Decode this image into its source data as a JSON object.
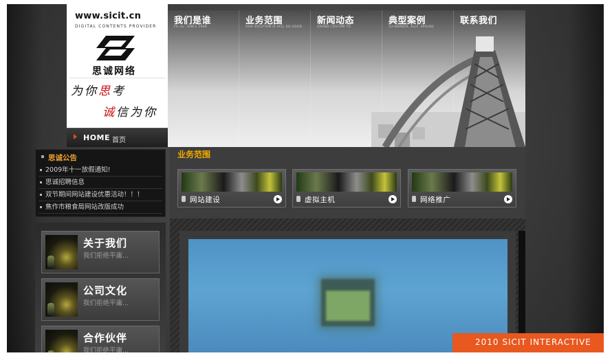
{
  "logo": {
    "site_url": "www.sicit.cn",
    "tagline": "DIGITAL CONTENTS PROVIDER",
    "brand_name": "思诚网络",
    "slogan_1_a": "为你",
    "slogan_1_b": "思",
    "slogan_1_c": "考",
    "slogan_2_a": "诚",
    "slogan_2_b": "信为你"
  },
  "home": {
    "label": "HOME",
    "sub": "首页"
  },
  "nav": {
    "items": [
      {
        "label": "我们是谁",
        "sub": "FG Inc. SINCE 1998"
      },
      {
        "label": "业务范围",
        "sub": "OUR SOLUTION IS FELL SO GOOD"
      },
      {
        "label": "新闻动态",
        "sub": "GRAND CUSTOM TO"
      },
      {
        "label": "典型案例",
        "sub": "CO-BRAKER, ALLY, SPOUSE"
      },
      {
        "label": "联系我们",
        "sub": ""
      }
    ]
  },
  "notice": {
    "title": "思诚公告",
    "items": [
      "2009年十一放假通知!",
      "思诚招聘信息",
      "双节期间网站建设优惠活动！！！",
      "焦作市粮食局网站改版成功"
    ]
  },
  "services": {
    "title": "业务范围",
    "items": [
      {
        "label": "网站建设"
      },
      {
        "label": "虚拟主机"
      },
      {
        "label": "网络推广"
      }
    ]
  },
  "features": {
    "items": [
      {
        "title": "关于我们",
        "desc": "我们拒绝平庸..."
      },
      {
        "title": "公司文化",
        "desc": "我们拒绝平庸..."
      },
      {
        "title": "合作伙伴",
        "desc": "我们拒绝平庸..."
      }
    ]
  },
  "footer": {
    "text": "2010 SICIT INTERACTIVE"
  },
  "colors": {
    "accent_orange": "#e8581f",
    "section_title": "#f0a800",
    "notice_title": "#f0a030"
  }
}
